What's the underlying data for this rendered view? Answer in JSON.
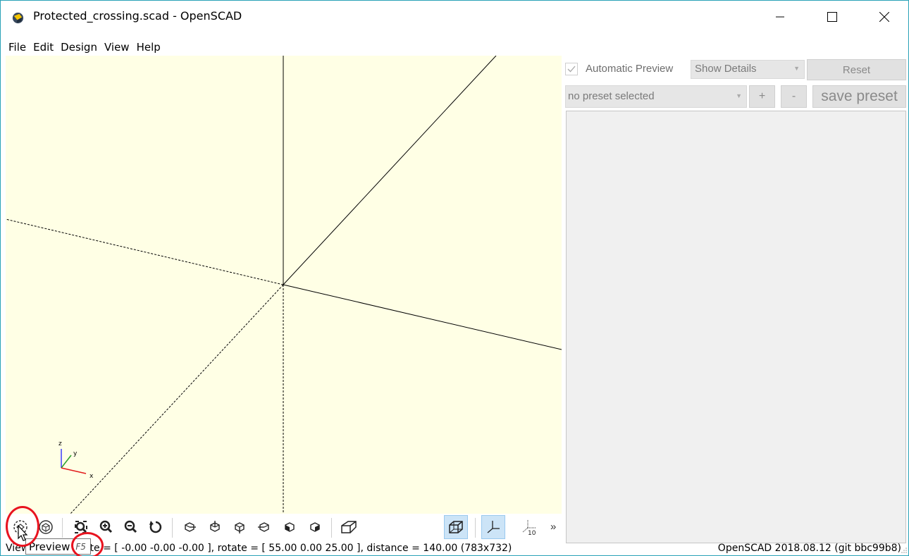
{
  "window": {
    "title": "Protected_crossing.scad - OpenSCAD",
    "app_icon": "openscad-logo-icon",
    "controls": [
      "minimize-icon",
      "maximize-icon",
      "close-icon"
    ]
  },
  "menu": {
    "items": [
      "File",
      "Edit",
      "Design",
      "View",
      "Help"
    ]
  },
  "viewport": {
    "background": "#ffffe5",
    "axes_indicator": {
      "z": "z",
      "y": "y",
      "x": "x"
    }
  },
  "toolbar": {
    "buttons": [
      {
        "icon": "preview-icon"
      },
      {
        "icon": "render-icon"
      },
      {
        "icon": "view-all-icon"
      },
      {
        "icon": "zoom-in-icon"
      },
      {
        "icon": "zoom-out-icon"
      },
      {
        "icon": "reset-view-icon"
      },
      {
        "icon": "view-right-icon"
      },
      {
        "icon": "view-top-icon"
      },
      {
        "icon": "view-bottom-icon"
      },
      {
        "icon": "view-left-icon"
      },
      {
        "icon": "view-front-icon"
      },
      {
        "icon": "view-back-icon"
      },
      {
        "icon": "perspective-icon"
      },
      {
        "icon": "orthogonal-icon",
        "active": true
      },
      {
        "icon": "show-axes-icon",
        "active": true
      },
      {
        "icon": "show-scale-icon"
      }
    ],
    "more": "»",
    "scale_label": "10"
  },
  "tooltip": {
    "label": "Preview",
    "shortcut": "F5"
  },
  "status": {
    "left": "Viewport: translate = [ -0.00 -0.00 -0.00 ], rotate = [ 55.00 0.00 25.00 ], distance = 140.00 (783x732)",
    "right": "OpenSCAD 2018.08.12 (git bbc99b8)"
  },
  "customizer": {
    "automatic_preview_label": "Automatic Preview",
    "automatic_preview_checked": true,
    "details_select": "Show Details",
    "reset_label": "Reset",
    "preset_select": "no preset selected",
    "plus_label": "+",
    "minus_label": "-",
    "save_preset_label": "save preset"
  },
  "colors": {
    "annotation_red": "#e8131f",
    "window_border": "#2aa2b7",
    "active_button": "#cce4f7"
  }
}
